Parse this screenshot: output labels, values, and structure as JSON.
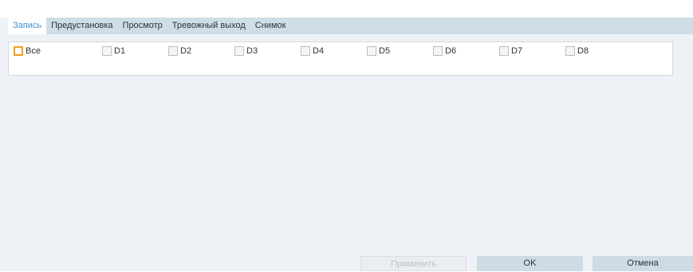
{
  "tabs": [
    {
      "label": "Запись"
    },
    {
      "label": "Предустановка"
    },
    {
      "label": "Просмотр"
    },
    {
      "label": "Тревожный выход"
    },
    {
      "label": "Снимок"
    }
  ],
  "channels": {
    "all_label": "Все",
    "items": [
      "D1",
      "D2",
      "D3",
      "D4",
      "D5",
      "D6",
      "D7",
      "D8"
    ]
  },
  "buttons": {
    "apply": "Применить",
    "ok": "OK",
    "cancel": "Отмена"
  },
  "colors": {
    "active_tab_text": "#3c8fd4",
    "tabbar_bg": "#cfdde6",
    "panel_bg": "#eef2f6",
    "checkbox_highlight": "#f0a020"
  }
}
